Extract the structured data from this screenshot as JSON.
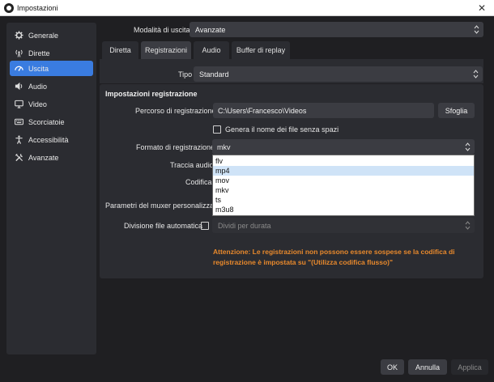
{
  "window": {
    "title": "Impostazioni",
    "close_glyph": "✕"
  },
  "sidebar": {
    "items": [
      {
        "label": "Generale",
        "icon": "gear-icon"
      },
      {
        "label": "Dirette",
        "icon": "broadcast-icon"
      },
      {
        "label": "Uscita",
        "icon": "output-icon",
        "active": true
      },
      {
        "label": "Audio",
        "icon": "speaker-icon"
      },
      {
        "label": "Video",
        "icon": "monitor-icon"
      },
      {
        "label": "Scorciatoie",
        "icon": "keyboard-icon"
      },
      {
        "label": "Accessibilità",
        "icon": "accessibility-icon"
      },
      {
        "label": "Avanzate",
        "icon": "tools-icon"
      }
    ]
  },
  "output_mode": {
    "label": "Modalità di uscita",
    "value": "Avanzate"
  },
  "tabs": [
    {
      "label": "Diretta"
    },
    {
      "label": "Registrazioni",
      "active": true
    },
    {
      "label": "Audio"
    },
    {
      "label": "Buffer di replay"
    }
  ],
  "type": {
    "label": "Tipo",
    "value": "Standard"
  },
  "recording": {
    "section_title": "Impostazioni registrazione",
    "path_label": "Percorso di registrazione",
    "path_value": "C:\\Users\\Francesco\\Videos",
    "browse_label": "Sfoglia",
    "nospace_label": "Genera il nome dei file senza spazi",
    "nospace_checked": false,
    "format_label": "Formato di registrazione",
    "format_value": "mkv",
    "format_options": [
      "flv",
      "mp4",
      "mov",
      "mkv",
      "ts",
      "m3u8"
    ],
    "format_highlighted": "mp4",
    "audio_track_label": "Traccia audio",
    "encoder_label": "Codifica",
    "muxer_label": "Parametri del muxer personalizzati",
    "split_label": "Divisione file automatica",
    "split_checked": false,
    "split_value": "Dividi per durata",
    "warning": "Attenzione: Le registrazioni non possono essere sospese se la codifica di registrazione è impostata su \"(Utilizza codifica flusso)\""
  },
  "footer": {
    "ok": "OK",
    "cancel": "Annulla",
    "apply": "Applica"
  },
  "colors": {
    "accent": "#3a7ce0",
    "warning": "#e8892c",
    "background": "#1f1f22",
    "panel": "#2b2c31"
  }
}
